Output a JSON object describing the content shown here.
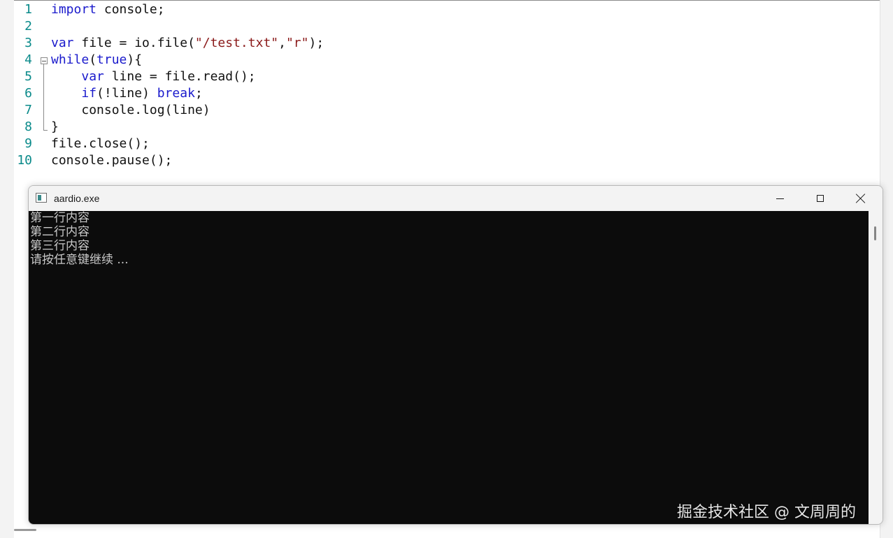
{
  "editor": {
    "line_numbers": [
      "1",
      "2",
      "3",
      "4",
      "5",
      "6",
      "7",
      "8",
      "9",
      "10"
    ],
    "lines": [
      {
        "indent": "",
        "tokens": [
          {
            "t": "import",
            "c": "kw"
          },
          {
            "t": " console;",
            "c": ""
          }
        ]
      },
      {
        "indent": "",
        "tokens": []
      },
      {
        "indent": "",
        "tokens": [
          {
            "t": "var",
            "c": "kw"
          },
          {
            "t": " file = io.file(",
            "c": ""
          },
          {
            "t": "\"/test.txt\"",
            "c": "str"
          },
          {
            "t": ",",
            "c": ""
          },
          {
            "t": "\"r\"",
            "c": "str"
          },
          {
            "t": ");",
            "c": ""
          }
        ]
      },
      {
        "indent": "",
        "tokens": [
          {
            "t": "while",
            "c": "kw"
          },
          {
            "t": "(",
            "c": ""
          },
          {
            "t": "true",
            "c": "kw"
          },
          {
            "t": "){",
            "c": ""
          }
        ]
      },
      {
        "indent": "    ",
        "tokens": [
          {
            "t": "var",
            "c": "kw"
          },
          {
            "t": " line = file.read();",
            "c": ""
          }
        ]
      },
      {
        "indent": "    ",
        "tokens": [
          {
            "t": "if",
            "c": "kw"
          },
          {
            "t": "(!line) ",
            "c": ""
          },
          {
            "t": "break",
            "c": "kw"
          },
          {
            "t": ";",
            "c": ""
          }
        ]
      },
      {
        "indent": "    ",
        "tokens": [
          {
            "t": "console.log(line)",
            "c": ""
          }
        ]
      },
      {
        "indent": "",
        "tokens": [
          {
            "t": "}",
            "c": ""
          }
        ]
      },
      {
        "indent": "",
        "tokens": [
          {
            "t": "file.close();",
            "c": ""
          }
        ]
      },
      {
        "indent": "",
        "tokens": [
          {
            "t": "console.pause();",
            "c": ""
          }
        ]
      }
    ]
  },
  "console_window": {
    "title": "aardio.exe",
    "icon": "console-app-icon",
    "buttons": {
      "minimize": "minimize-icon",
      "maximize": "maximize-icon",
      "close": "close-icon"
    },
    "output_lines": [
      "第一行内容",
      "第二行内容",
      "第三行内容",
      "请按任意键继续 ..."
    ]
  },
  "watermark": "掘金技术社区 @ 文周周的",
  "colors": {
    "keyword": "#1a1acc",
    "string": "#8b1a1a",
    "line_number": "#0a8a8a",
    "console_background": "#0c0c0c",
    "console_text": "#c8c8c8"
  }
}
